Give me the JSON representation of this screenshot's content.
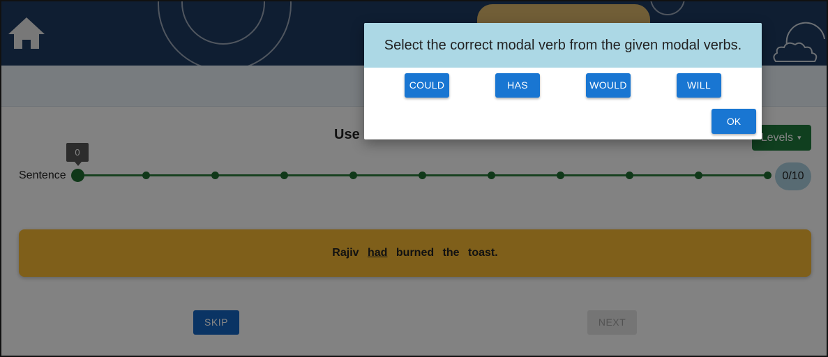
{
  "header": {
    "home_icon": "home-icon"
  },
  "activity": {
    "title": "Use",
    "levels_label": "Levels",
    "progress_label": "Sentence",
    "current_marker": "0",
    "counter": "0/10",
    "progress_value": 0,
    "step_count": 10
  },
  "sentence": {
    "words": [
      "Rajiv",
      "had",
      "burned",
      "the",
      "toast."
    ],
    "underlined_word": "had"
  },
  "controls": {
    "skip_label": "SKIP",
    "next_label": "NEXT"
  },
  "dialog": {
    "prompt": "Select the correct modal verb from the given modal verbs.",
    "options": [
      "COULD",
      "HAS",
      "WOULD",
      "WILL"
    ],
    "ok_label": "OK"
  }
}
